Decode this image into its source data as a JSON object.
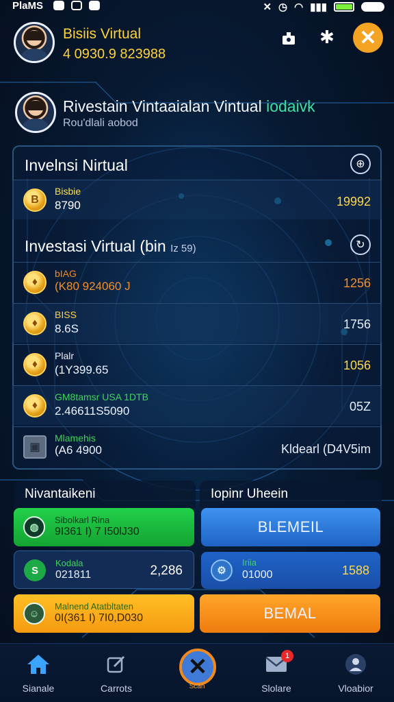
{
  "status_bar": {
    "carrier": "PlaMS"
  },
  "header": {
    "title": "Bisiis Virtual",
    "balance": "4 0930.9 823988"
  },
  "profile": {
    "title_main": "Rivestain Vintaaialan Vintual ",
    "title_highlight": "iodaivk",
    "subtitle": "Rou'dlali aobod"
  },
  "section1": {
    "title": "Invelnsi Nirtual",
    "rows": [
      {
        "name": "Bisbie",
        "value": "8790",
        "amount": "19992",
        "name_color": "#ffe04a",
        "amount_color": "#ffd84a",
        "value_color": "#ffffff"
      }
    ]
  },
  "section2": {
    "title": "Investasi Virtual (bin",
    "title_small": "Iz 59)",
    "rows": [
      {
        "name": "bIAG",
        "value": "(K80 924060  J",
        "amount": "1256",
        "name_color": "#f28a22",
        "amount_color": "#f2902a",
        "value_color": "#f2902a",
        "icon": "coin"
      },
      {
        "name": "BISS",
        "value": "8.6S",
        "amount": "1756",
        "name_color": "#ffd24a",
        "amount_color": "#e8eefc",
        "value_color": "#e8eefc",
        "icon": "coin"
      },
      {
        "name": "Plalr",
        "value": "(1Y399.65",
        "amount": "1056",
        "name_color": "#e8eefc",
        "amount_color": "#ffd84a",
        "value_color": "#e8eefc",
        "icon": "coin"
      },
      {
        "name": "GM8tamsr USA 1DTB",
        "value": "2.46611S5090",
        "amount": "05Z",
        "name_color": "#3ed55a",
        "amount_color": "#e8eefc",
        "value_color": "#e8eefc",
        "icon": "coin"
      },
      {
        "name": "Mlamehis",
        "value": "(A6 4900",
        "amount": "Kldearl (D4V5im",
        "name_color": "#3ed55a",
        "amount_color": "#e8eefc",
        "value_color": "#e8eefc",
        "icon": "square"
      }
    ]
  },
  "card_left": {
    "header": "Nivantaikeni",
    "tiles": [
      {
        "name": "Sibolkarl Rina",
        "value": "9I361 I) 7 I50lJ30",
        "amount": ""
      },
      {
        "name": "Kodala",
        "value": "021811",
        "amount": "2,286"
      },
      {
        "name": "Malnend Atatbltaten",
        "value": "0I(361 I) 7I0,D030",
        "amount": ""
      }
    ]
  },
  "card_right": {
    "header": "Iopinr Uheein",
    "button1": "BLEMEIL",
    "tile": {
      "name": "Iriia",
      "value": "01000",
      "amount": "1588"
    },
    "button2": "BEMAL"
  },
  "nav": {
    "items": [
      {
        "label": "Sianale",
        "icon": "home-icon"
      },
      {
        "label": "Carrots",
        "icon": "edit-icon"
      },
      {
        "label": "Scan",
        "icon": "close-circle-icon"
      },
      {
        "label": "Slolare",
        "icon": "mail-icon"
      },
      {
        "label": "Vloabior",
        "icon": "user-icon"
      }
    ],
    "mail_badge": "1"
  },
  "colors": {
    "accent_yellow": "#ffd23a",
    "close_orange": "#f5a322",
    "green_button": "#1fc63a",
    "blue_button": "#2d7ee0",
    "orange_button": "#f2a318"
  }
}
